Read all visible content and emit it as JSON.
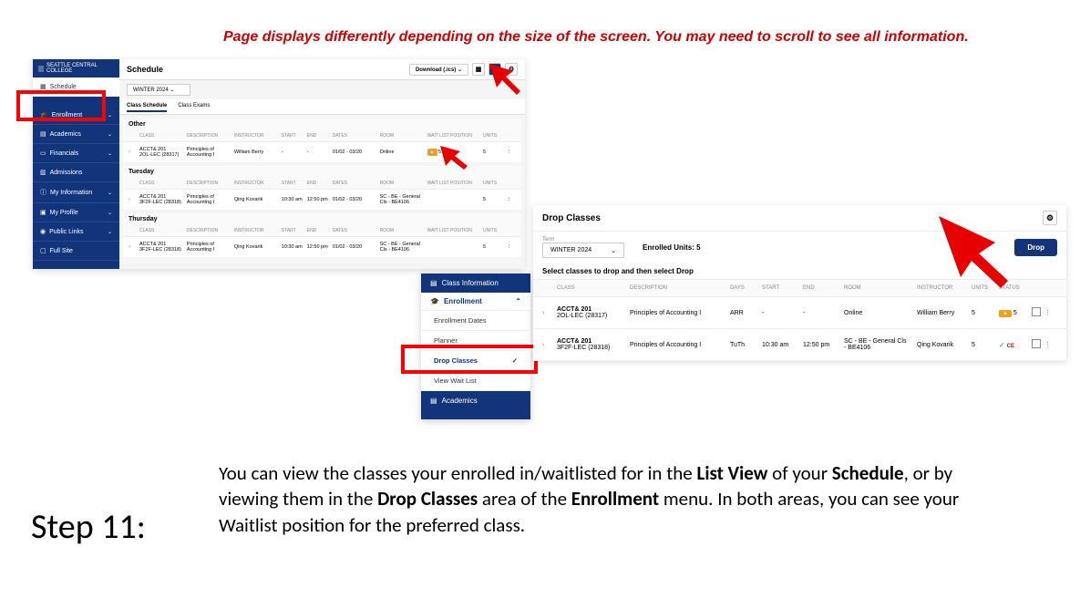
{
  "warning": "Page displays differently depending on the size of the screen. You may need to scroll to see all information.",
  "ss1": {
    "college": "SEATTLE CENTRAL COLLEGE",
    "title": "Schedule",
    "download": "Download (.ics)",
    "term": "WINTER 2024",
    "nav": {
      "schedule": "Schedule",
      "enrollment": "Enrollment",
      "academics": "Academics",
      "financials": "Financials",
      "admissions": "Admissions",
      "myinfo": "My Information",
      "myprofile": "My Profile",
      "publiclinks": "Public Links",
      "fullsite": "Full Site"
    },
    "tabs": {
      "class_schedule": "Class Schedule",
      "class_exams": "Class Exams"
    },
    "days": {
      "other": "Other",
      "tuesday": "Tuesday",
      "thursday": "Thursday"
    },
    "cols": {
      "class": "CLASS",
      "desc": "DESCRIPTION",
      "instructor": "INSTRUCTOR",
      "start": "START",
      "end": "END",
      "dates": "DATES",
      "room": "ROOM",
      "wl": "WAIT LIST POSITION",
      "units": "UNITS"
    },
    "rows": {
      "other": {
        "class": "ACCT& 201",
        "class2": "2OL-LEC (28317)",
        "desc": "Principles of Accounting I",
        "instructor": "William Berry",
        "start": "-",
        "end": "-",
        "dates": "01/02 - 03/20",
        "room": "Online",
        "wl": "5",
        "units": "5"
      },
      "tue": {
        "class": "ACCT& 201",
        "class2": "3F2F-LEC (28318)",
        "desc": "Principles of Accounting I",
        "instructor": "Qing Kovarik",
        "start": "10:30 am",
        "end": "12:50 pm",
        "dates": "01/02 - 03/20",
        "room": "SC - BE - General Cls - BE4106",
        "wl": "",
        "units": "5"
      },
      "thu": {
        "class": "ACCT& 201",
        "class2": "3F2F-LEC (28318)",
        "desc": "Principles of Accounting I",
        "instructor": "Qing Kovarik",
        "start": "10:30 am",
        "end": "12:50 pm",
        "dates": "01/02 - 03/20",
        "room": "SC - BE - General Cls - BE4106",
        "wl": "",
        "units": "5"
      }
    }
  },
  "ss2": {
    "class_info": "Class Information",
    "enrollment": "Enrollment",
    "items": {
      "dates": "Enrollment Dates",
      "planner": "Planner",
      "drop": "Drop Classes",
      "waitlist": "View Wait List"
    },
    "academics": "Academics"
  },
  "ss3": {
    "title": "Drop Classes",
    "term_label": "Term",
    "term": "WINTER 2024",
    "enrolled": "Enrolled Units: 5",
    "drop_btn": "Drop",
    "instruction": "Select classes to drop and then select Drop",
    "cols": {
      "class": "CLASS",
      "desc": "DESCRIPTION",
      "days": "DAYS",
      "start": "START",
      "end": "END",
      "room": "ROOM",
      "instructor": "INSTRUCTOR",
      "units": "UNITS",
      "status": "STATUS"
    },
    "rows": [
      {
        "class": "ACCT& 201",
        "class2": "2OL-LEC (28317)",
        "desc": "Principles of Accounting I",
        "days": "ARR",
        "start": "-",
        "end": "-",
        "room": "Online",
        "instructor": "William Berry",
        "units": "5",
        "wl": "5"
      },
      {
        "class": "ACCT& 201",
        "class2": "3F2F-LEC (28318)",
        "desc": "Principles of Accounting I",
        "days": "TuTh",
        "start": "10:30 am",
        "end": "12:50 pm",
        "room": "SC - BE - General Cls - BE4106",
        "instructor": "Qing Kovarik",
        "units": "5",
        "ce": "CE"
      }
    ]
  },
  "step": {
    "label": "Step 11:",
    "desc_parts": {
      "p1": "You can view the classes your enrolled in/waitlisted for in the ",
      "b1": "List View",
      "p2": " of your ",
      "b2": "Schedule",
      "p3": ", or by viewing them in the ",
      "b3": "Drop Classes",
      "p4": " area of the ",
      "b4": "Enrollment",
      "p5": " menu. In both areas, you can see your Waitlist position for the preferred class."
    }
  }
}
